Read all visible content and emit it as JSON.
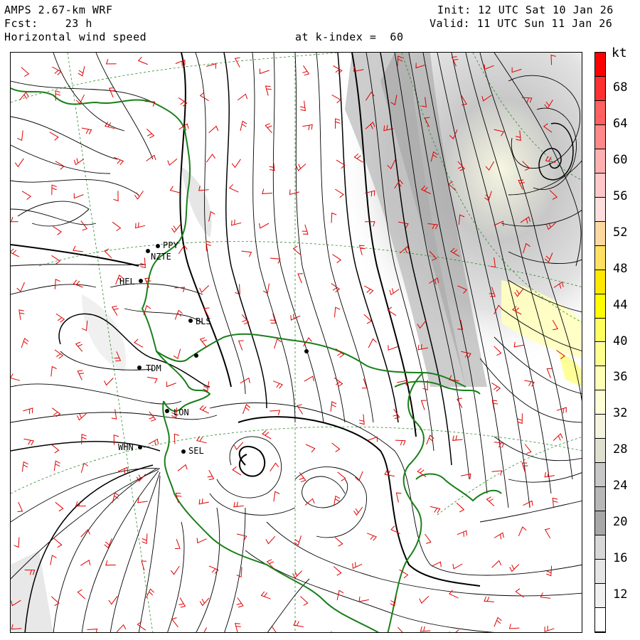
{
  "header": {
    "model": "AMPS 2.67-km WRF",
    "forecast": "Fcst:    23 h",
    "field": "Horizontal wind speed",
    "init": "Init: 12 UTC Sat 10 Jan 26",
    "valid": "Valid: 11 UTC Sun 11 Jan 26",
    "level": "at k-index =  60"
  },
  "colorbar": {
    "unit": "kt",
    "labels": [
      "68",
      "64",
      "60",
      "56",
      "52",
      "48",
      "44",
      "40",
      "36",
      "32",
      "28",
      "24",
      "20",
      "16",
      "12"
    ],
    "colors": [
      "#ff0000",
      "#ff3030",
      "#ff6060",
      "#ff8888",
      "#ffb0b0",
      "#ffc8c8",
      "#ffdede",
      "#ffd8a0",
      "#ffe060",
      "#ffe800",
      "#ffff00",
      "#ffff60",
      "#ffff90",
      "#ffffb8",
      "#ffffd6",
      "#f4f4e0",
      "#e0e0d0",
      "#c8c8c8",
      "#b8b8b8",
      "#a8a8a8",
      "#d8d8d8",
      "#e6e6e6",
      "#f0f0f0",
      "#ffffff"
    ]
  },
  "stations": [
    {
      "id": "station-ppy",
      "label": "PPY"
    },
    {
      "id": "station-nzte",
      "label": "NZTE"
    },
    {
      "id": "station-hel",
      "label": "HEL"
    },
    {
      "id": "station-bls",
      "label": "BLS"
    },
    {
      "id": "station-tdm",
      "label": "TDM"
    },
    {
      "id": "station-lon",
      "label": "LON"
    },
    {
      "id": "station-whn",
      "label": "WHN"
    },
    {
      "id": "station-sel",
      "label": "SEL"
    }
  ]
}
